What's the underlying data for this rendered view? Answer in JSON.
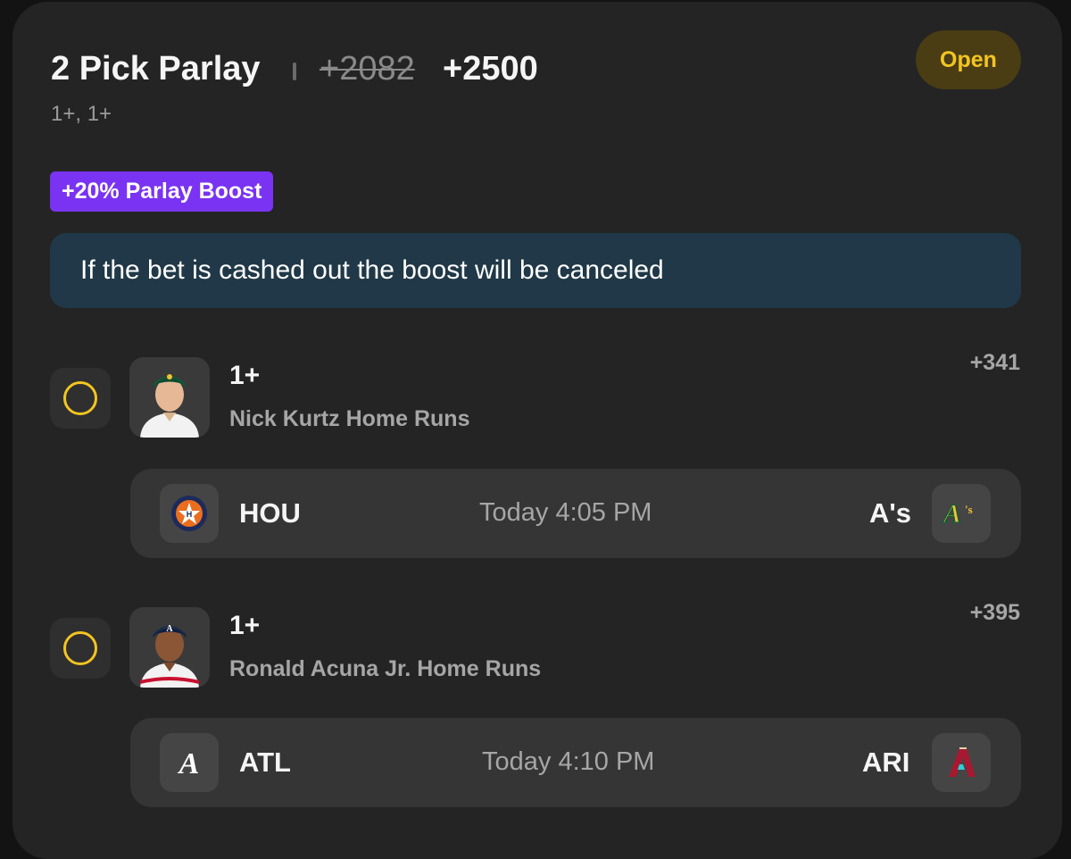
{
  "header": {
    "title": "2 Pick Parlay",
    "old_odds": "+2082",
    "new_odds": "+2500",
    "subtitle": "1+, 1+",
    "status": "Open"
  },
  "boost": {
    "label": "+20% Parlay Boost",
    "notice": "If the bet is cashed out the boost will be canceled"
  },
  "picks": [
    {
      "line": "1+",
      "description": "Nick Kurtz Home Runs",
      "odds": "+341",
      "player_icon": "player-headshot-athletics",
      "game": {
        "away_team": "HOU",
        "away_logo": "astros-logo-icon",
        "time": "Today 4:05 PM",
        "home_team": "A's",
        "home_logo": "athletics-logo-icon"
      }
    },
    {
      "line": "1+",
      "description": "Ronald Acuna Jr. Home Runs",
      "odds": "+395",
      "player_icon": "player-headshot-braves",
      "game": {
        "away_team": "ATL",
        "away_logo": "braves-logo-icon",
        "time": "Today 4:10 PM",
        "home_team": "ARI",
        "home_logo": "diamondbacks-logo-icon"
      }
    }
  ],
  "colors": {
    "accent_yellow": "#f3c521",
    "boost_purple": "#7a33f2",
    "notice_bg": "#203847"
  }
}
